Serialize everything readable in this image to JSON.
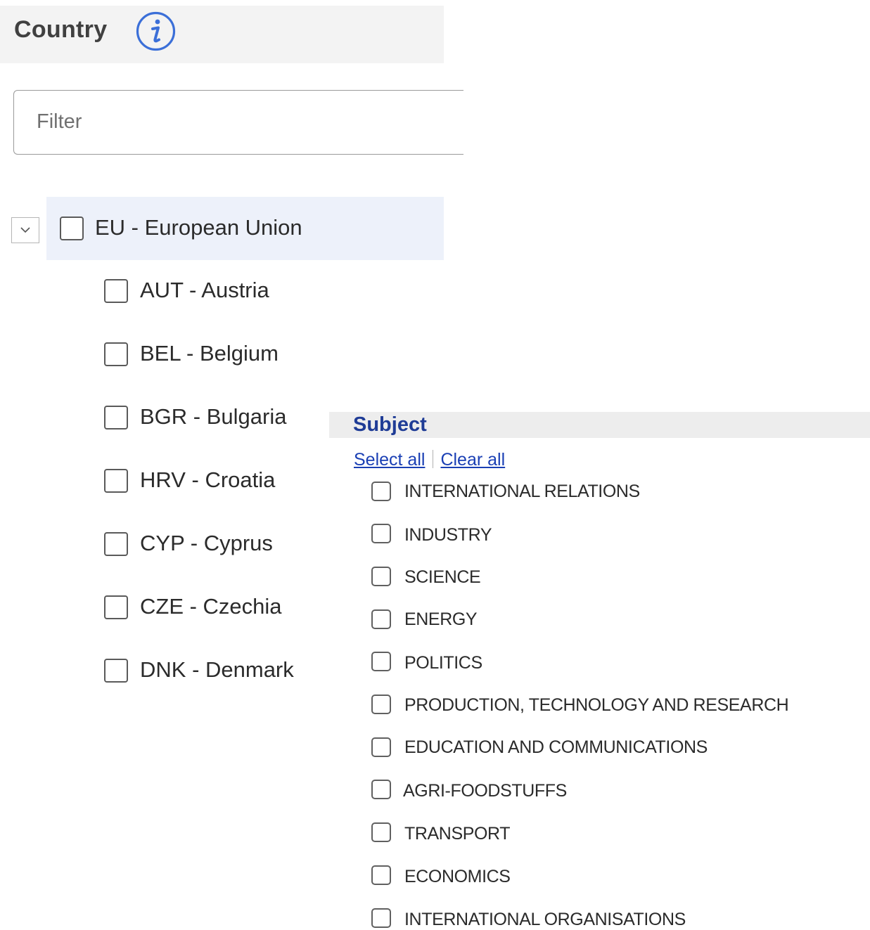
{
  "country": {
    "title": "Country",
    "info_icon": "info-circle-icon",
    "filter": {
      "placeholder": "Filter",
      "value": ""
    },
    "tree": {
      "expander_icon": "chevron-down-icon",
      "expanded": true,
      "root": {
        "label": "EU - European Union",
        "checked": false
      },
      "children": [
        {
          "label": "AUT - Austria",
          "checked": false
        },
        {
          "label": "BEL - Belgium",
          "checked": false
        },
        {
          "label": "BGR - Bulgaria",
          "checked": false
        },
        {
          "label": "HRV - Croatia",
          "checked": false
        },
        {
          "label": "CYP - Cyprus",
          "checked": false
        },
        {
          "label": "CZE - Czechia",
          "checked": false
        },
        {
          "label": "DNK - Denmark",
          "checked": false
        }
      ]
    }
  },
  "subject": {
    "title": "Subject",
    "select_all": "Select all",
    "clear_all": "Clear all",
    "items": [
      {
        "label": "INTERNATIONAL RELATIONS",
        "checked": false
      },
      {
        "label": "INDUSTRY",
        "checked": false
      },
      {
        "label": "SCIENCE",
        "checked": false
      },
      {
        "label": "ENERGY",
        "checked": false
      },
      {
        "label": "POLITICS",
        "checked": false
      },
      {
        "label": "PRODUCTION, TECHNOLOGY AND RESEARCH",
        "checked": false
      },
      {
        "label": "EDUCATION AND COMMUNICATIONS",
        "checked": false
      },
      {
        "label": "AGRI-FOODSTUFFS",
        "checked": false
      },
      {
        "label": "TRANSPORT",
        "checked": false
      },
      {
        "label": "ECONOMICS",
        "checked": false
      },
      {
        "label": "INTERNATIONAL ORGANISATIONS",
        "checked": false
      }
    ]
  },
  "colors": {
    "accent": "#1f3c96",
    "link": "#1a3fb4",
    "info_icon": "#3b6fd8",
    "highlight_row": "#edf1fa"
  }
}
